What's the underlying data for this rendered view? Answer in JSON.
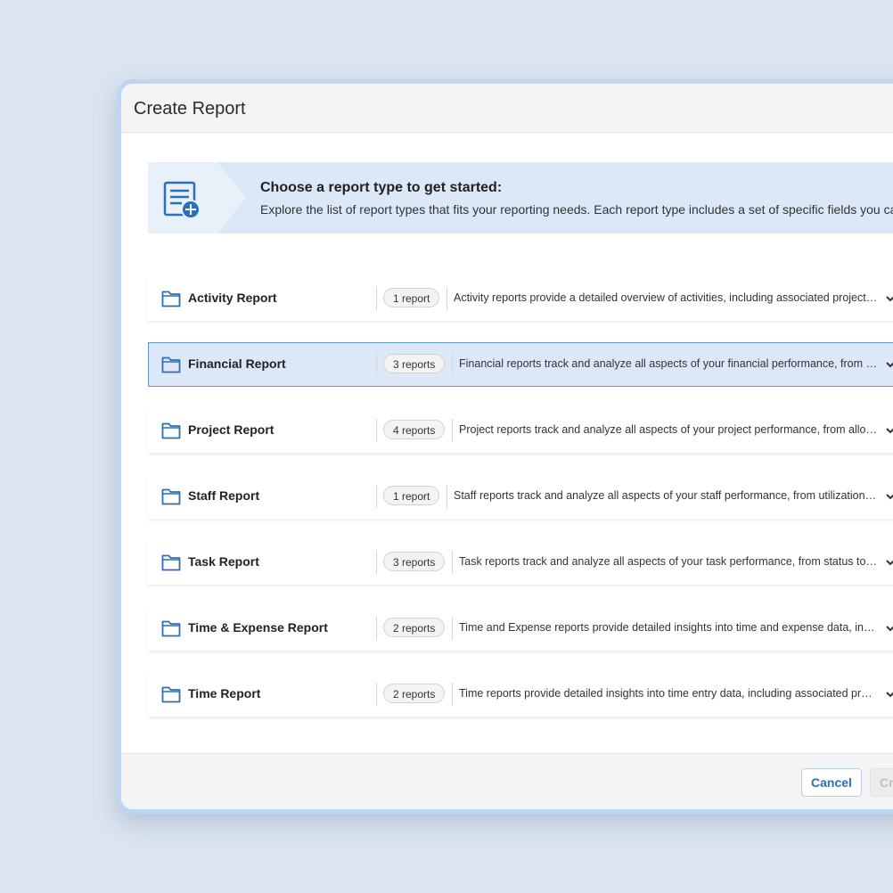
{
  "dialog": {
    "title": "Create Report"
  },
  "banner": {
    "icon": "report-add-icon",
    "heading": "Choose a report type to get started:",
    "text": "Explore the list of report types that fits your reporting needs. Each report type includes a set of specific fields you ca"
  },
  "report_types": [
    {
      "name": "Activity Report",
      "count": "1 report",
      "description": "Activity reports provide a detailed overview of activities, including associated project details and more",
      "selected": false
    },
    {
      "name": "Financial Report",
      "count": "3 reports",
      "description": "Financial reports track and analyze all aspects of your financial performance, from revenue to costs",
      "selected": true
    },
    {
      "name": "Project Report",
      "count": "4 reports",
      "description": "Project reports track and analyze all aspects of your project performance, from allocation to budget",
      "selected": false
    },
    {
      "name": "Staff Report",
      "count": "1 report",
      "description": "Staff reports track and analyze all aspects of your staff performance, from utilization to availability",
      "selected": false
    },
    {
      "name": "Task Report",
      "count": "3 reports",
      "description": "Task reports track and analyze all aspects of your task performance, from status to progress",
      "selected": false
    },
    {
      "name": "Time & Expense Report",
      "count": "2 reports",
      "description": "Time and Expense reports provide detailed insights into time and expense data, including approvals",
      "selected": false
    },
    {
      "name": "Time Report",
      "count": "2 reports",
      "description": "Time reports provide detailed insights into time entry data, including associated projects and tasks",
      "selected": false
    }
  ],
  "footer": {
    "cancel_label": "Cancel",
    "create_label": "Cr"
  },
  "colors": {
    "accent": "#2b6fb8",
    "selected_row_bg": "#dce8f7",
    "selected_row_border": "#5d96d4",
    "banner_bg": "#dbe8f7",
    "page_bg": "#dce6f2"
  }
}
